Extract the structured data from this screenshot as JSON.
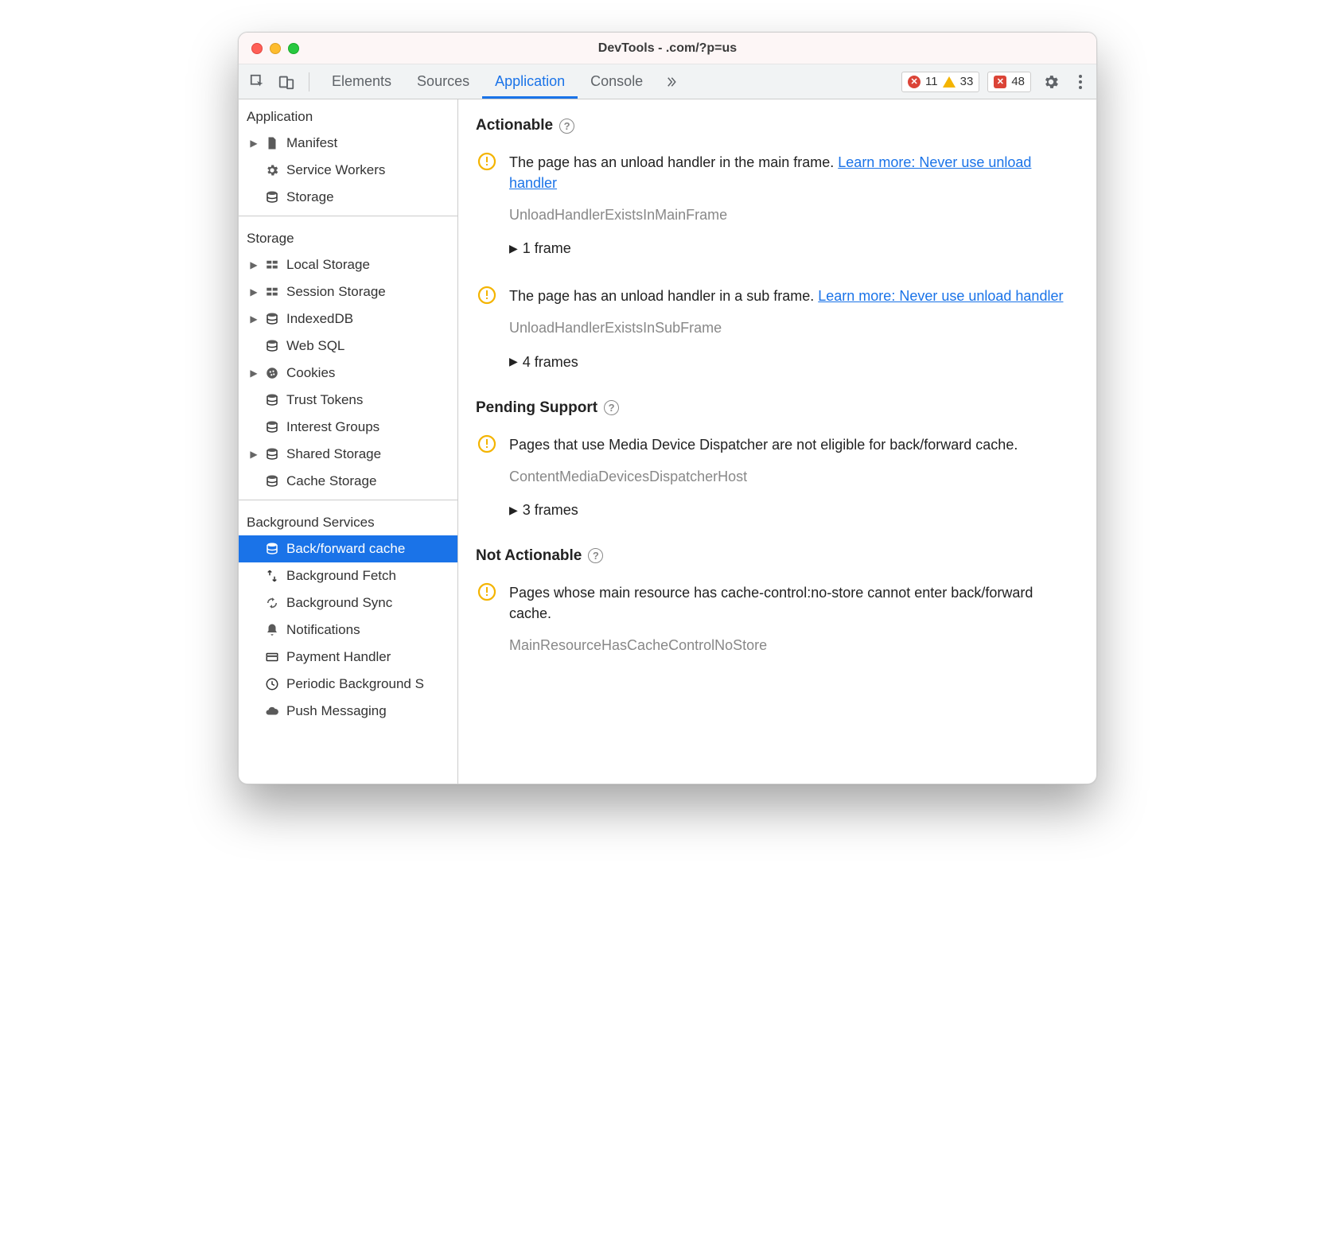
{
  "window": {
    "title": "DevTools -            .com/?p=us"
  },
  "toolbar": {
    "tabs": [
      {
        "label": "Elements"
      },
      {
        "label": "Sources"
      },
      {
        "label": "Application"
      },
      {
        "label": "Console"
      }
    ],
    "active_tab_index": 2,
    "errors": "11",
    "warnings": "33",
    "issues": "48"
  },
  "sidebar": {
    "groups": [
      {
        "title": "Application",
        "items": [
          {
            "label": "Manifest",
            "icon": "file",
            "caret": true
          },
          {
            "label": "Service Workers",
            "icon": "gear",
            "caret": false
          },
          {
            "label": "Storage",
            "icon": "db",
            "caret": false
          }
        ]
      },
      {
        "title": "Storage",
        "items": [
          {
            "label": "Local Storage",
            "icon": "grid",
            "caret": true
          },
          {
            "label": "Session Storage",
            "icon": "grid",
            "caret": true
          },
          {
            "label": "IndexedDB",
            "icon": "db",
            "caret": true
          },
          {
            "label": "Web SQL",
            "icon": "db",
            "caret": false
          },
          {
            "label": "Cookies",
            "icon": "cookie",
            "caret": true
          },
          {
            "label": "Trust Tokens",
            "icon": "db",
            "caret": false
          },
          {
            "label": "Interest Groups",
            "icon": "db",
            "caret": false
          },
          {
            "label": "Shared Storage",
            "icon": "db",
            "caret": true
          },
          {
            "label": "Cache Storage",
            "icon": "db",
            "caret": false
          }
        ]
      },
      {
        "title": "Background Services",
        "items": [
          {
            "label": "Back/forward cache",
            "icon": "db",
            "caret": false,
            "selected": true
          },
          {
            "label": "Background Fetch",
            "icon": "fetch",
            "caret": false
          },
          {
            "label": "Background Sync",
            "icon": "sync",
            "caret": false
          },
          {
            "label": "Notifications",
            "icon": "bell",
            "caret": false
          },
          {
            "label": "Payment Handler",
            "icon": "card",
            "caret": false
          },
          {
            "label": "Periodic Background Sync",
            "icon": "clock",
            "caret": false,
            "truncated": "Periodic Background S"
          },
          {
            "label": "Push Messaging",
            "icon": "cloud",
            "caret": false,
            "truncated": "Push Messaging"
          }
        ]
      }
    ]
  },
  "main": {
    "sections": [
      {
        "title": "Actionable",
        "issues": [
          {
            "text": "The page has an unload handler in the main frame. ",
            "link": "Learn more: Never use unload handler",
            "code": "UnloadHandlerExistsInMainFrame",
            "frames": "1 frame"
          },
          {
            "text": "The page has an unload handler in a sub frame. ",
            "link": "Learn more: Never use unload handler",
            "code": "UnloadHandlerExistsInSubFrame",
            "frames": "4 frames"
          }
        ]
      },
      {
        "title": "Pending Support",
        "issues": [
          {
            "text": "Pages that use Media Device Dispatcher are not eligible for back/forward cache.",
            "link": "",
            "code": "ContentMediaDevicesDispatcherHost",
            "frames": "3 frames"
          }
        ]
      },
      {
        "title": "Not Actionable",
        "issues": [
          {
            "text": "Pages whose main resource has cache-control:no-store cannot enter back/forward cache.",
            "link": "",
            "code": "MainResourceHasCacheControlNoStore",
            "frames": ""
          }
        ]
      }
    ]
  }
}
